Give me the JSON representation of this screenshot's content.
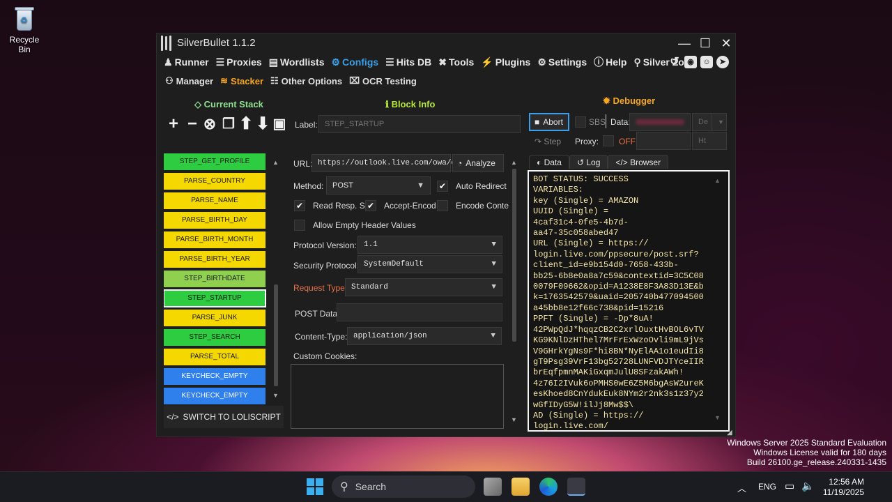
{
  "desktop": {
    "recycle_bin": "Recycle Bin",
    "watermark": [
      "Windows Server 2025 Standard Evaluation",
      "Windows License valid for 180 days",
      "Build 26100.ge_release.240331-1435"
    ]
  },
  "window": {
    "title": "SilverBullet 1.1.2"
  },
  "menu": [
    "Runner",
    "Proxies",
    "Wordlists",
    "Configs",
    "Hits DB",
    "Tools",
    "Plugins",
    "Settings",
    "Help",
    "Silver Zone"
  ],
  "submenu": [
    "Manager",
    "Stacker",
    "Other Options",
    "OCR Testing"
  ],
  "sections": {
    "current_stack": "Current Stack",
    "block_info": "Block Info",
    "debugger": "Debugger"
  },
  "toolbar": {
    "label_text": "Label:",
    "label_value": "STEP_STARTUP"
  },
  "stack": [
    {
      "name": "STEP_GET_PROFILE",
      "color": "green"
    },
    {
      "name": "PARSE_COUNTRY",
      "color": "yellow"
    },
    {
      "name": "PARSE_NAME",
      "color": "yellow"
    },
    {
      "name": "PARSE_BIRTH_DAY",
      "color": "yellow"
    },
    {
      "name": "PARSE_BIRTH_MONTH",
      "color": "yellow"
    },
    {
      "name": "PARSE_BIRTH_YEAR",
      "color": "yellow"
    },
    {
      "name": "STEP_BIRTHDATE",
      "color": "lgreen"
    },
    {
      "name": "STEP_STARTUP",
      "color": "green",
      "selected": true
    },
    {
      "name": "PARSE_JUNK",
      "color": "yellow"
    },
    {
      "name": "STEP_SEARCH",
      "color": "green"
    },
    {
      "name": "PARSE_TOTAL",
      "color": "yellow"
    },
    {
      "name": "KEYCHECK_EMPTY",
      "color": "blue"
    },
    {
      "name": "KEYCHECK_EMPTY",
      "color": "blue"
    }
  ],
  "switch_btn": "SWITCH TO LOLISCRIPT",
  "block": {
    "url_label": "URL:",
    "url_value": "https://outlook.live.com/owa/c",
    "analyze": "Analyze",
    "method_label": "Method:",
    "method_value": "POST",
    "auto_redirect": "Auto Redirect",
    "read_resp": "Read Resp. So",
    "accept_encod": "Accept-Encod",
    "encode_conte": "Encode Conte",
    "allow_empty": "Allow Empty Header Values",
    "protocol_label": "Protocol Version:",
    "protocol_value": "1.1",
    "security_label": "Security Protocol:",
    "security_value": "SystemDefault",
    "request_type_label": "Request Type:",
    "request_type_value": "Standard",
    "post_data_label": "POST Data:",
    "content_type_label": "Content-Type:",
    "content_type_value": "application/json",
    "custom_cookies_label": "Custom Cookies:"
  },
  "debugger": {
    "abort": "Abort",
    "sbs": "SBS",
    "data_label": "Data:",
    "de": "De",
    "step": "Step",
    "proxy_label": "Proxy:",
    "proxy_state": "OFF",
    "ht": "Ht",
    "tabs": [
      "Data",
      "Log",
      "Browser"
    ],
    "console": [
      "BOT STATUS: SUCCESS",
      "VARIABLES:",
      "key (Single) = AMAZON",
      "UUID (Single) =",
      "4caf31c4-0fe5-4b7d-",
      "aa47-35c058abed47",
      "URL (Single) = https://",
      "login.live.com/ppsecure/post.srf?",
      "client_id=e9b154d0-7658-433b-",
      "bb25-6b8e0a8a7c59&contextid=3C5C08",
      "0079F09662&opid=A1238E8F3A83D13E&b",
      "k=1763542579&uaid=205740b477094500",
      "a45bb8e12f66c738&pid=15216",
      "PPFT (Single) = -Dp*8uA!",
      "42PWpQdJ*hqqzCB2C2xrlOuxtHvBOL6vTV",
      "KG9KNlDzHThel7MrFrExWzoOvli9mL9jVs",
      "V9GHrkYgNs9F*hi8BN*NyElAA1o1eudIi8",
      "gT9Psg39VrF13bg52728LUNFVDJTYceIIR",
      "brEqfpmnMAKiGxqmJulU8SFzakAWh!",
      "4z76I2IVuk6oPMHS0wE6Z5M6bgAsW2ureK",
      "esKhoed8CnYdukEuk8NYm2r2nk3s1z37y2",
      "wGfIDyG5W!ilJj8Mw$$\\",
      "AD (Single) = https://",
      "login.live.com/"
    ]
  },
  "taskbar": {
    "search": "Search",
    "lang": "ENG",
    "time": "12:56 AM",
    "date": "11/19/2025"
  }
}
